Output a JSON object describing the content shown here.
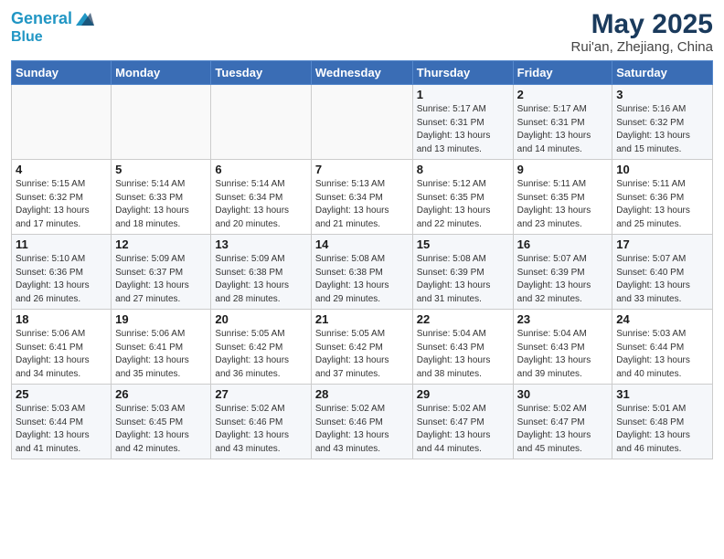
{
  "header": {
    "logo_line1": "General",
    "logo_line2": "Blue",
    "title": "May 2025",
    "subtitle": "Rui'an, Zhejiang, China"
  },
  "days_of_week": [
    "Sunday",
    "Monday",
    "Tuesday",
    "Wednesday",
    "Thursday",
    "Friday",
    "Saturday"
  ],
  "weeks": [
    [
      {
        "day": "",
        "detail": ""
      },
      {
        "day": "",
        "detail": ""
      },
      {
        "day": "",
        "detail": ""
      },
      {
        "day": "",
        "detail": ""
      },
      {
        "day": "1",
        "detail": "Sunrise: 5:17 AM\nSunset: 6:31 PM\nDaylight: 13 hours\nand 13 minutes."
      },
      {
        "day": "2",
        "detail": "Sunrise: 5:17 AM\nSunset: 6:31 PM\nDaylight: 13 hours\nand 14 minutes."
      },
      {
        "day": "3",
        "detail": "Sunrise: 5:16 AM\nSunset: 6:32 PM\nDaylight: 13 hours\nand 15 minutes."
      }
    ],
    [
      {
        "day": "4",
        "detail": "Sunrise: 5:15 AM\nSunset: 6:32 PM\nDaylight: 13 hours\nand 17 minutes."
      },
      {
        "day": "5",
        "detail": "Sunrise: 5:14 AM\nSunset: 6:33 PM\nDaylight: 13 hours\nand 18 minutes."
      },
      {
        "day": "6",
        "detail": "Sunrise: 5:14 AM\nSunset: 6:34 PM\nDaylight: 13 hours\nand 20 minutes."
      },
      {
        "day": "7",
        "detail": "Sunrise: 5:13 AM\nSunset: 6:34 PM\nDaylight: 13 hours\nand 21 minutes."
      },
      {
        "day": "8",
        "detail": "Sunrise: 5:12 AM\nSunset: 6:35 PM\nDaylight: 13 hours\nand 22 minutes."
      },
      {
        "day": "9",
        "detail": "Sunrise: 5:11 AM\nSunset: 6:35 PM\nDaylight: 13 hours\nand 23 minutes."
      },
      {
        "day": "10",
        "detail": "Sunrise: 5:11 AM\nSunset: 6:36 PM\nDaylight: 13 hours\nand 25 minutes."
      }
    ],
    [
      {
        "day": "11",
        "detail": "Sunrise: 5:10 AM\nSunset: 6:36 PM\nDaylight: 13 hours\nand 26 minutes."
      },
      {
        "day": "12",
        "detail": "Sunrise: 5:09 AM\nSunset: 6:37 PM\nDaylight: 13 hours\nand 27 minutes."
      },
      {
        "day": "13",
        "detail": "Sunrise: 5:09 AM\nSunset: 6:38 PM\nDaylight: 13 hours\nand 28 minutes."
      },
      {
        "day": "14",
        "detail": "Sunrise: 5:08 AM\nSunset: 6:38 PM\nDaylight: 13 hours\nand 29 minutes."
      },
      {
        "day": "15",
        "detail": "Sunrise: 5:08 AM\nSunset: 6:39 PM\nDaylight: 13 hours\nand 31 minutes."
      },
      {
        "day": "16",
        "detail": "Sunrise: 5:07 AM\nSunset: 6:39 PM\nDaylight: 13 hours\nand 32 minutes."
      },
      {
        "day": "17",
        "detail": "Sunrise: 5:07 AM\nSunset: 6:40 PM\nDaylight: 13 hours\nand 33 minutes."
      }
    ],
    [
      {
        "day": "18",
        "detail": "Sunrise: 5:06 AM\nSunset: 6:41 PM\nDaylight: 13 hours\nand 34 minutes."
      },
      {
        "day": "19",
        "detail": "Sunrise: 5:06 AM\nSunset: 6:41 PM\nDaylight: 13 hours\nand 35 minutes."
      },
      {
        "day": "20",
        "detail": "Sunrise: 5:05 AM\nSunset: 6:42 PM\nDaylight: 13 hours\nand 36 minutes."
      },
      {
        "day": "21",
        "detail": "Sunrise: 5:05 AM\nSunset: 6:42 PM\nDaylight: 13 hours\nand 37 minutes."
      },
      {
        "day": "22",
        "detail": "Sunrise: 5:04 AM\nSunset: 6:43 PM\nDaylight: 13 hours\nand 38 minutes."
      },
      {
        "day": "23",
        "detail": "Sunrise: 5:04 AM\nSunset: 6:43 PM\nDaylight: 13 hours\nand 39 minutes."
      },
      {
        "day": "24",
        "detail": "Sunrise: 5:03 AM\nSunset: 6:44 PM\nDaylight: 13 hours\nand 40 minutes."
      }
    ],
    [
      {
        "day": "25",
        "detail": "Sunrise: 5:03 AM\nSunset: 6:44 PM\nDaylight: 13 hours\nand 41 minutes."
      },
      {
        "day": "26",
        "detail": "Sunrise: 5:03 AM\nSunset: 6:45 PM\nDaylight: 13 hours\nand 42 minutes."
      },
      {
        "day": "27",
        "detail": "Sunrise: 5:02 AM\nSunset: 6:46 PM\nDaylight: 13 hours\nand 43 minutes."
      },
      {
        "day": "28",
        "detail": "Sunrise: 5:02 AM\nSunset: 6:46 PM\nDaylight: 13 hours\nand 43 minutes."
      },
      {
        "day": "29",
        "detail": "Sunrise: 5:02 AM\nSunset: 6:47 PM\nDaylight: 13 hours\nand 44 minutes."
      },
      {
        "day": "30",
        "detail": "Sunrise: 5:02 AM\nSunset: 6:47 PM\nDaylight: 13 hours\nand 45 minutes."
      },
      {
        "day": "31",
        "detail": "Sunrise: 5:01 AM\nSunset: 6:48 PM\nDaylight: 13 hours\nand 46 minutes."
      }
    ]
  ]
}
